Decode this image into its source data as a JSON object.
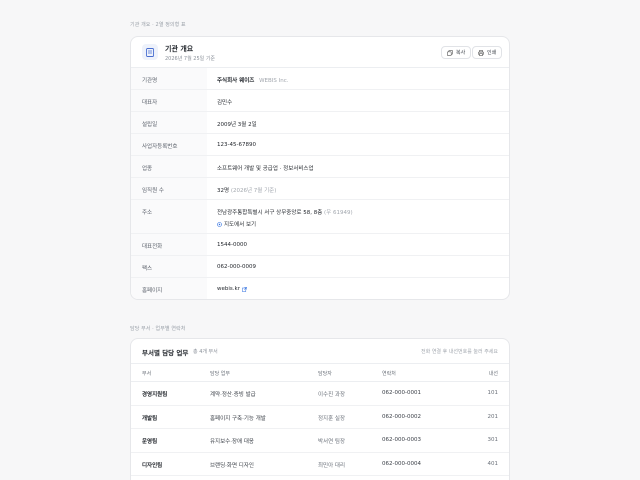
{
  "overview_label": "기관 개요 · 2열 정의형 표",
  "card": {
    "title": "기관 개요",
    "subtitle": "2026년 7월 25일 기준",
    "copy_label": "복사",
    "print_label": "인쇄",
    "rows": [
      {
        "label": "기관명",
        "value": "주식회사 웨이즈",
        "extra": "WEBIS Inc."
      },
      {
        "label": "대표자",
        "value": "김민수"
      },
      {
        "label": "설립일",
        "value": "2009년 3월 2일"
      },
      {
        "label": "사업자등록번호",
        "value": "123-45-67890"
      },
      {
        "label": "업종",
        "value": "소프트웨어 개발 및 공급업 · 정보서비스업"
      },
      {
        "label": "임직원 수",
        "value": "32명",
        "extra": "(2026년 7월 기준)"
      },
      {
        "label": "주소",
        "value": "전남광주통합특별시 서구 상무중앙로 58, 8층",
        "extra": "(우 61949)",
        "link": "지도에서 보기"
      },
      {
        "label": "대표전화",
        "value": "1544-0000"
      },
      {
        "label": "팩스",
        "value": "062-000-0009"
      },
      {
        "label": "홈페이지",
        "value": "webis.kr"
      }
    ]
  },
  "dept_label": "담당 부서 · 업무별 연락처",
  "dept": {
    "title": "부서별 담당 업무",
    "count": "총 4개 부서",
    "hint": "전화 연결 후 내선번호를 눌러 주세요",
    "headers": [
      "부서",
      "담당 업무",
      "담당자",
      "연락처",
      "내선"
    ],
    "rows": [
      [
        "경영지원팀",
        "계약·정산·증빙 발급",
        "이수진 과장",
        "062-000-0001",
        "101"
      ],
      [
        "개발팀",
        "홈페이지 구축·기능 개발",
        "정지훈 실장",
        "062-000-0002",
        "201"
      ],
      [
        "운영팀",
        "유지보수·장애 대응",
        "박서연 팀장",
        "062-000-0003",
        "301"
      ],
      [
        "디자인팀",
        "브랜딩·화면 디자인",
        "최민아 대리",
        "062-000-0004",
        "401"
      ]
    ]
  },
  "colors": {
    "accent": "#2f6fdf",
    "border": "#e6e7ea",
    "label_bg": "#fafafb"
  }
}
